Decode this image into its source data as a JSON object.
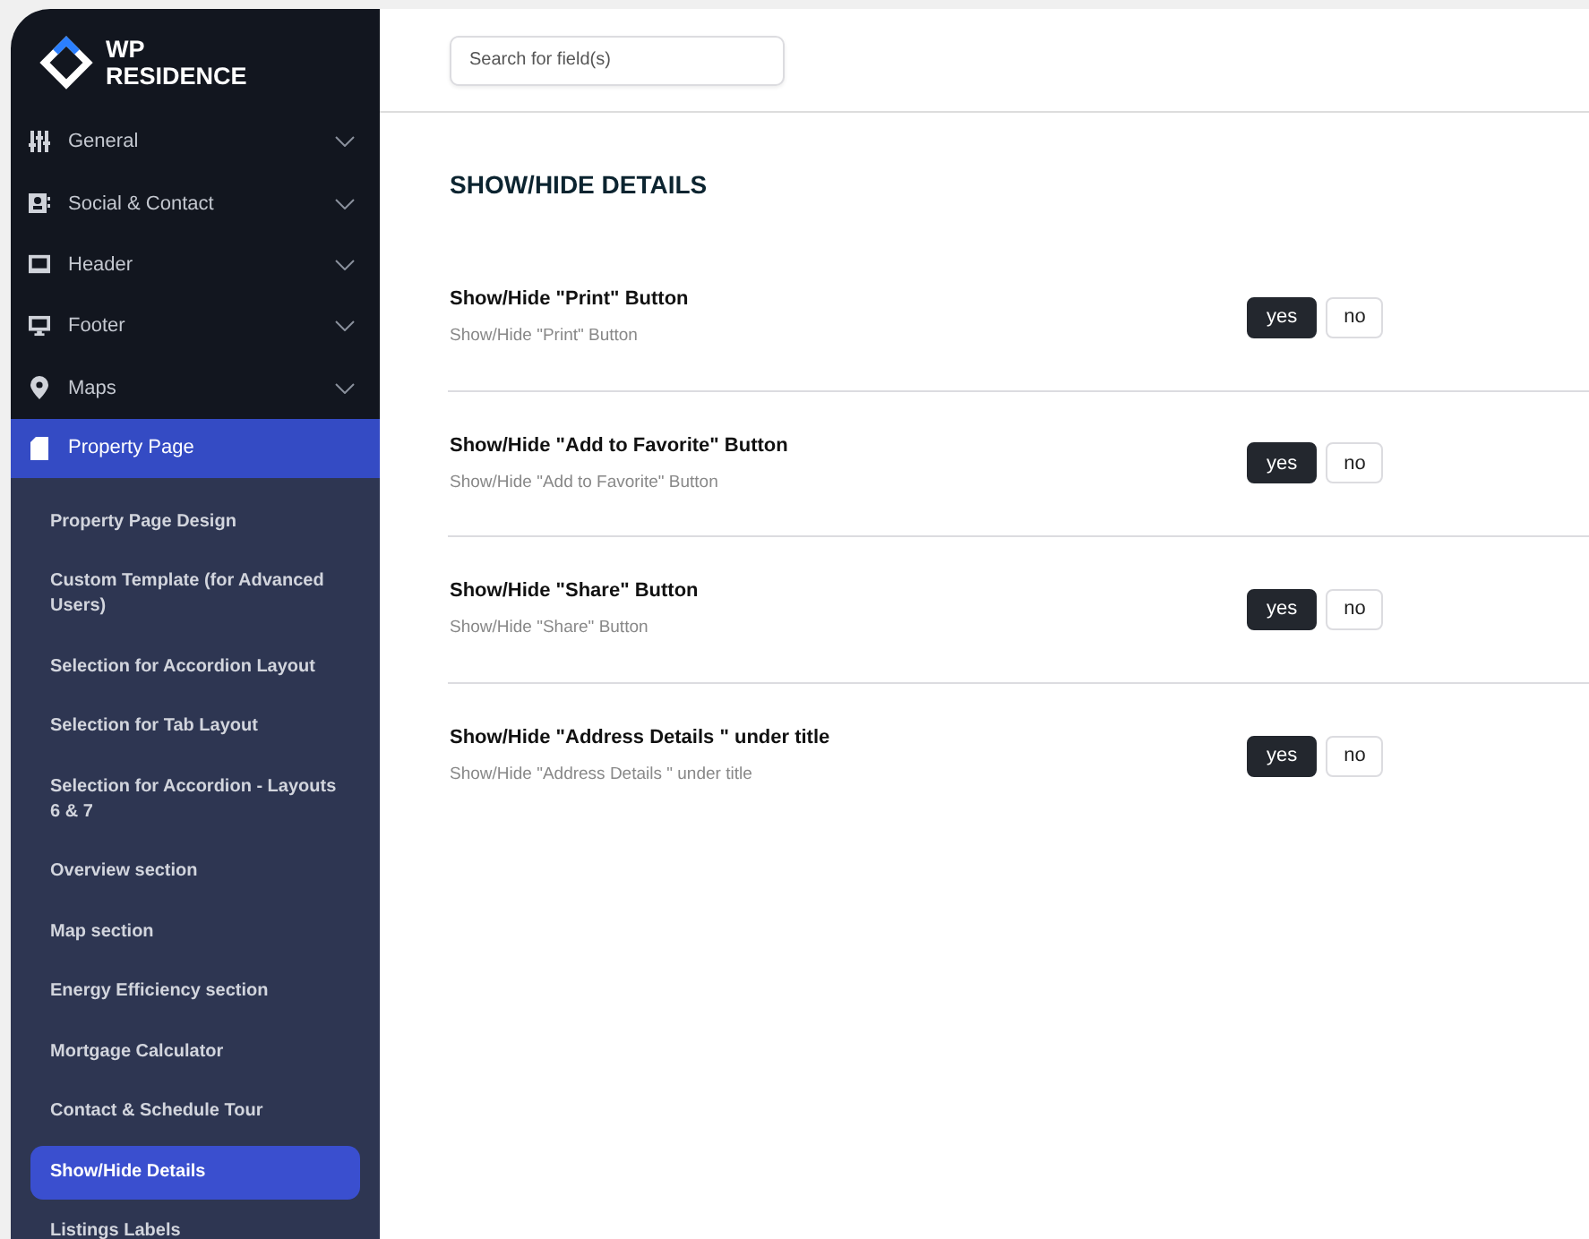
{
  "logo": {
    "line_1": "WP",
    "line_2": "RESIDENCE"
  },
  "menu": [
    {
      "label": "General",
      "kind": "sliders",
      "expanded": false,
      "selected": false
    },
    {
      "label": "Social & Contact",
      "kind": "card",
      "expanded": false,
      "selected": false
    },
    {
      "label": "Header",
      "kind": "laptop",
      "expanded": false,
      "selected": false
    },
    {
      "label": "Footer",
      "kind": "monitor",
      "expanded": false,
      "selected": false
    },
    {
      "label": "Maps",
      "kind": "pin",
      "expanded": false,
      "selected": false
    },
    {
      "label": "Property Page",
      "kind": "document",
      "expanded": true,
      "selected": true,
      "children": [
        {
          "label": "Property Page Design",
          "selected": false
        },
        {
          "label": "Custom Template (for Advanced Users)",
          "selected": false
        },
        {
          "label": "Selection for Accordion Layout",
          "selected": false
        },
        {
          "label": "Selection for Tab Layout",
          "selected": false
        },
        {
          "label": "Selection for Accordion - Layouts 6 & 7",
          "selected": false
        },
        {
          "label": "Overview section",
          "selected": false
        },
        {
          "label": "Map section",
          "selected": false
        },
        {
          "label": "Energy Efficiency section",
          "selected": false
        },
        {
          "label": "Mortgage Calculator",
          "selected": false
        },
        {
          "label": "Contact & Schedule Tour",
          "selected": false
        },
        {
          "label": "Show/Hide Details",
          "selected": true
        },
        {
          "label": "Listings Labels",
          "selected": false
        }
      ]
    }
  ],
  "search": {
    "placeholder": "Search for field(s)"
  },
  "section_title": "SHOW/HIDE DETAILS",
  "settings": [
    {
      "title": "Show/Hide \"Print\" Button",
      "description": "Show/Hide \"Print\" Button",
      "options": [
        {
          "label": "yes",
          "selected": true
        },
        {
          "label": "no",
          "selected": false
        }
      ]
    },
    {
      "title": "Show/Hide \"Add to Favorite\" Button",
      "description": "Show/Hide \"Add to Favorite\" Button",
      "options": [
        {
          "label": "yes",
          "selected": true
        },
        {
          "label": "no",
          "selected": false
        }
      ]
    },
    {
      "title": "Show/Hide \"Share\" Button",
      "description": "Show/Hide \"Share\" Button",
      "options": [
        {
          "label": "yes",
          "selected": true
        },
        {
          "label": "no",
          "selected": false
        }
      ]
    },
    {
      "title": "Show/Hide \"Address Details \" under title",
      "description": "Show/Hide \"Address Details \" under title",
      "options": [
        {
          "label": "yes",
          "selected": true
        },
        {
          "label": "no",
          "selected": false
        }
      ]
    }
  ]
}
